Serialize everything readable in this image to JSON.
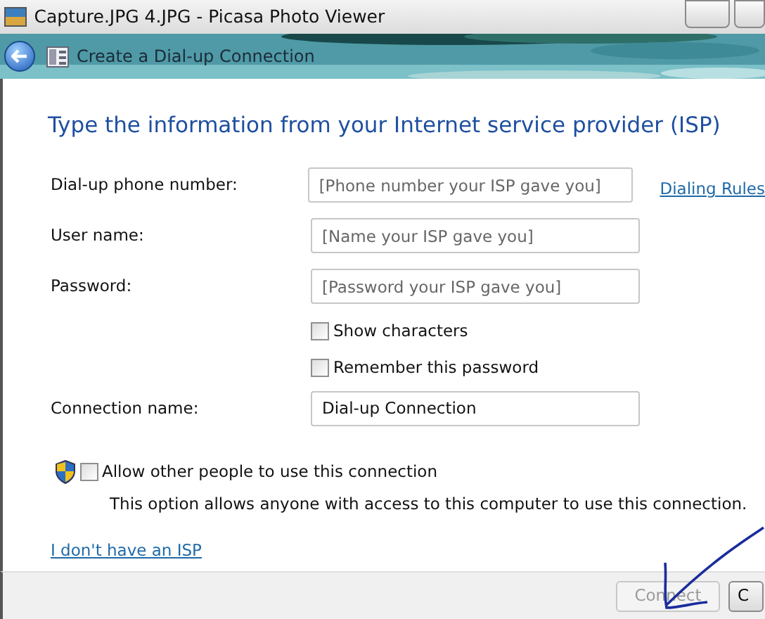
{
  "window": {
    "title": "Capture.JPG 4.JPG - Picasa Photo Viewer"
  },
  "header": {
    "title": "Create a Dial-up Connection"
  },
  "heading": "Type the information from your Internet service provider (ISP)",
  "fields": [
    {
      "kind": "text",
      "label": "Dial-up phone number:",
      "placeholder": "[Phone number your ISP gave you]",
      "link": "Dialing Rules"
    },
    {
      "kind": "text",
      "label": "User name:",
      "placeholder": "[Name your ISP gave you]"
    },
    {
      "kind": "password",
      "label": "Password:",
      "placeholder": "[Password your ISP gave you]"
    },
    {
      "kind": "checkbox",
      "label": "Show characters",
      "checked": false
    },
    {
      "kind": "checkbox",
      "label": "Remember this password",
      "checked": false
    },
    {
      "kind": "text",
      "label": "Connection name:",
      "value": "Dial-up Connection"
    }
  ],
  "allow": {
    "label": "Allow other people to use this connection",
    "checked": false,
    "note": "This option allows anyone with access to this computer to use this connection."
  },
  "link": "I don't have an ISP",
  "buttons": [
    {
      "label": "Connect",
      "disabled": true
    },
    {
      "label": "C",
      "disabled": false
    }
  ]
}
